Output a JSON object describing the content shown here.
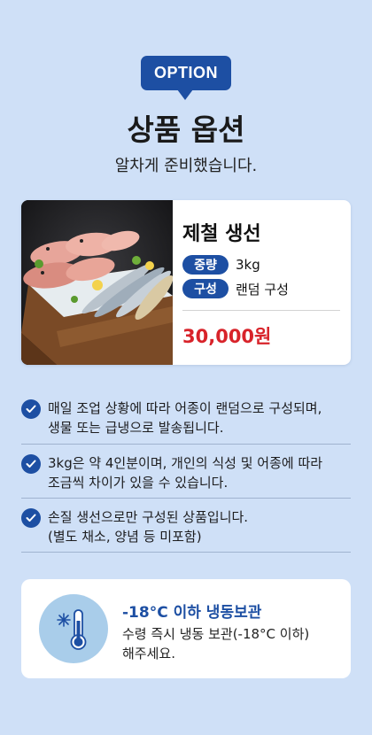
{
  "header": {
    "badge": "OPTION",
    "title": "상품 옵션",
    "subtitle": "알차게 준비했습니다."
  },
  "product": {
    "name": "제철 생선",
    "specs": [
      {
        "tag": "중량",
        "value": "3kg"
      },
      {
        "tag": "구성",
        "value": "랜덤 구성"
      }
    ],
    "price": "30,000원"
  },
  "notices": [
    {
      "line1": "매일 조업 상황에 따라 어종이 랜덤으로 구성되며,",
      "line2": "생물 또는 급냉으로 발송됩니다."
    },
    {
      "line1": "3kg은 약 4인분이며, 개인의 식성 및 어종에 따라",
      "line2": "조금씩 차이가 있을 수 있습니다."
    },
    {
      "line1": "손질 생선으로만 구성된 상품입니다.",
      "line2": "(별도 채소, 양념 등 미포함)"
    }
  ],
  "storage": {
    "title": "-18°C 이하 냉동보관",
    "desc_line1": "수령 즉시 냉동 보관(-18°C 이하)",
    "desc_line2": "해주세요.",
    "icon": "thermometer-snowflake-icon"
  },
  "colors": {
    "background": "#cfe0f7",
    "accent": "#1d4fa3",
    "price": "#d8232a"
  }
}
